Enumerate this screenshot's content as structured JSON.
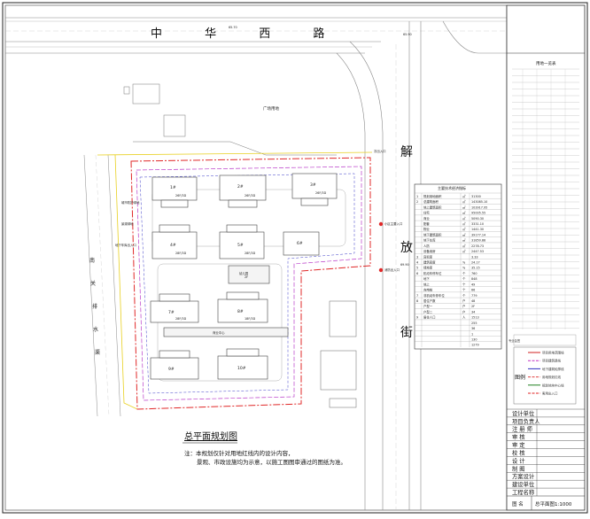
{
  "drawing": {
    "title": "总平面规划图",
    "note_line1": "注：本规划仅针对用地红线内的设计内容，",
    "note_line2": "景观、市政设施均为示意，以施工图图审通过的图纸为准。"
  },
  "roads": {
    "north": "中 华 西 路",
    "east": [
      "解",
      "放",
      "街"
    ],
    "west_river": [
      "南",
      "关",
      "排",
      "水",
      "渠"
    ],
    "north_elev": "65.70",
    "north_east_elev": "65.90",
    "east_elev": "69.90"
  },
  "site_labels": {
    "plaza": "广场用地",
    "main_entrance": "小区主要入口",
    "secondary_entrance": "消防出入口",
    "west_green": "景观绿地",
    "west_buffer": "城市防护绿地",
    "west_lane": "地下车库出入口",
    "north_entrance": "次出入口",
    "kindergarten": "幼儿园",
    "south_label": "商业中心"
  },
  "buildings": [
    {
      "id": "b1",
      "label": "1#"
    },
    {
      "id": "b2",
      "label": "2#"
    },
    {
      "id": "b3",
      "label": "3#"
    },
    {
      "id": "b4",
      "label": "4#"
    },
    {
      "id": "b5",
      "label": "5#"
    },
    {
      "id": "b6",
      "label": "6#"
    },
    {
      "id": "b7",
      "label": "7#"
    },
    {
      "id": "b8",
      "label": "8#"
    },
    {
      "id": "b9",
      "label": "9#"
    },
    {
      "id": "b10",
      "label": "10#"
    }
  ],
  "floor_tags": {
    "t1": "26F/3D",
    "t2": "26F/3D",
    "t3": "26F/3D",
    "t4": "28F/3D",
    "t5": "28F/3D",
    "t6": "28F/3D",
    "t7": "18F/3D",
    "t8": "2F"
  },
  "econ_table": {
    "title": "主要技术经济指标",
    "rows": [
      {
        "n": "1",
        "item": "规划用地面积",
        "unit": "㎡",
        "value": "31300"
      },
      {
        "n": "2",
        "item": "总建筑面积",
        "unit": "㎡",
        "value": "143085.10"
      },
      {
        "n": "",
        "item": "地上建筑面积",
        "unit": "㎡",
        "value": "103917.95"
      },
      {
        "n": "",
        "item": "住宅",
        "unit": "㎡",
        "value": "95005.55"
      },
      {
        "n": "",
        "item": "商业",
        "unit": "㎡",
        "value": "5090.30"
      },
      {
        "n": "",
        "item": "配套",
        "unit": "㎡",
        "value": "3331.10"
      },
      {
        "n": "",
        "item": "物业",
        "unit": "㎡",
        "value": "1441.30"
      },
      {
        "n": "",
        "item": "地下建筑面积",
        "unit": "㎡",
        "value": "39177.14"
      },
      {
        "n": "",
        "item": "地下车库",
        "unit": "㎡",
        "value": "31850.88"
      },
      {
        "n": "",
        "item": "人防",
        "unit": "㎡",
        "value": "2278.73"
      },
      {
        "n": "",
        "item": "设备用房",
        "unit": "㎡",
        "value": "2447.53"
      },
      {
        "n": "3",
        "item": "容积率",
        "unit": "",
        "value": "3.33"
      },
      {
        "n": "4",
        "item": "建筑密度",
        "unit": "%",
        "value": "24.17"
      },
      {
        "n": "5",
        "item": "绿地率",
        "unit": "%",
        "value": "35.15"
      },
      {
        "n": "6",
        "item": "机动车停车位",
        "unit": "个",
        "value": "760"
      },
      {
        "n": "",
        "item": "地下",
        "unit": "个",
        "value": "848"
      },
      {
        "n": "",
        "item": "地上",
        "unit": "个",
        "value": "49"
      },
      {
        "n": "",
        "item": "充电桩",
        "unit": "个",
        "value": "66"
      },
      {
        "n": "7",
        "item": "非机动车停车位",
        "unit": "个",
        "value": "779"
      },
      {
        "n": "8",
        "item": "居住户数",
        "unit": "户",
        "value": "48"
      },
      {
        "n": "",
        "item": "户型一",
        "unit": "户",
        "value": "2F"
      },
      {
        "n": "",
        "item": "户型二",
        "unit": "户",
        "value": "34"
      },
      {
        "n": "9",
        "item": "居住人口",
        "unit": "人",
        "value": "1513"
      },
      {
        "n": "",
        "item": "",
        "unit": "",
        "value": "255"
      },
      {
        "n": "",
        "item": "",
        "unit": "",
        "value": "36"
      },
      {
        "n": "",
        "item": "",
        "unit": "",
        "value": "1"
      },
      {
        "n": "",
        "item": "",
        "unit": "",
        "value": "130"
      },
      {
        "n": "",
        "item": "",
        "unit": "",
        "value": "1279"
      }
    ]
  },
  "title_block": {
    "top_header": "用地一览表",
    "legend_title": "图例",
    "legend_items": [
      {
        "label": "项目用地范围线",
        "color": "#d02020"
      },
      {
        "label": "项目建筑退线",
        "color": "#c030c0"
      },
      {
        "label": "地下建筑轮廓线",
        "color": "#3030c0"
      },
      {
        "label": "用地规划红线",
        "color": "#e04040"
      },
      {
        "label": "规划地块中心线",
        "color": "#208020"
      },
      {
        "label": "客用出入口",
        "color": "#e02020"
      }
    ],
    "rows": [
      {
        "label": "设计单位",
        "value": ""
      },
      {
        "label": "项目负责人",
        "value": ""
      },
      {
        "label": "注 册 师",
        "value": ""
      },
      {
        "label": "审    核",
        "value": ""
      },
      {
        "label": "审    定",
        "value": ""
      },
      {
        "label": "校    核",
        "value": ""
      },
      {
        "label": "设    计",
        "value": ""
      },
      {
        "label": "制    图",
        "value": ""
      },
      {
        "label": "方案设计",
        "value": ""
      },
      {
        "label": "建设单位",
        "value": ""
      },
      {
        "label": "工程名称",
        "value": ""
      }
    ],
    "sheet_label": "图    名",
    "sheet_value": "总平面图1:1000",
    "stamp_label": "专业会签"
  },
  "colors": {
    "red_line": "#e02828",
    "magenta_line": "#b83ac8",
    "blue_line": "#3a3ac8",
    "yellow_line": "#e8d020",
    "road_gray": "#9a9a9a"
  }
}
